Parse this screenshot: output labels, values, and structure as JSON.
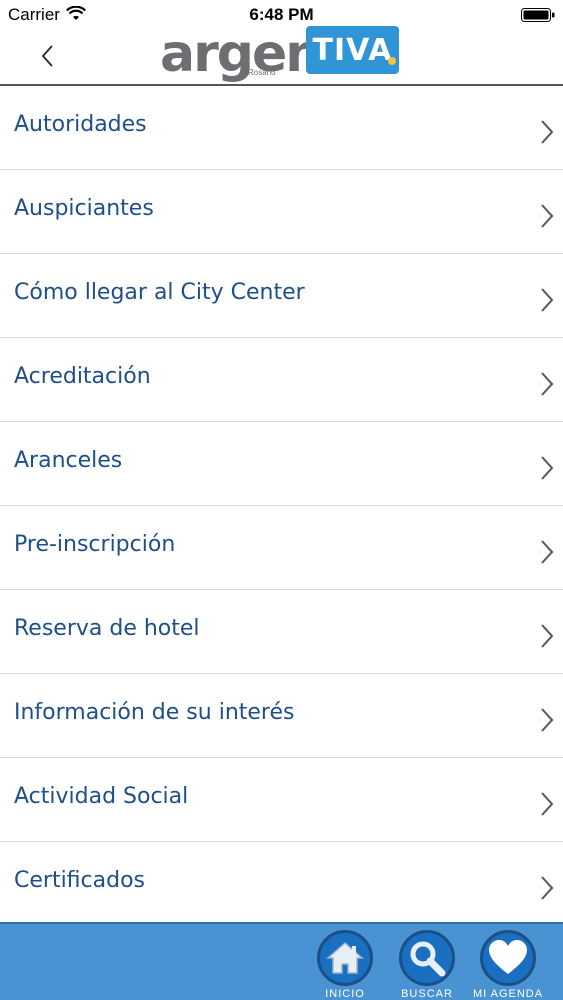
{
  "status_bar": {
    "carrier": "Carrier",
    "time": "6:48 PM"
  },
  "header": {
    "logo_text_left": "argen",
    "logo_text_right": "TIVA",
    "logo_subtitle": "Rosario",
    "back_icon": "chevron-left-icon"
  },
  "menu": {
    "items": [
      {
        "label": "Autoridades"
      },
      {
        "label": "Auspiciantes"
      },
      {
        "label": "Cómo llegar al City Center"
      },
      {
        "label": "Acreditación"
      },
      {
        "label": "Aranceles"
      },
      {
        "label": "Pre-inscripción"
      },
      {
        "label": "Reserva de hotel"
      },
      {
        "label": "Información de su interés"
      },
      {
        "label": "Actividad Social"
      },
      {
        "label": "Certificados"
      }
    ]
  },
  "tab_bar": {
    "tabs": [
      {
        "label": "INICIO",
        "icon": "home-icon"
      },
      {
        "label": "BUSCAR",
        "icon": "search-icon"
      },
      {
        "label": "MI AGENDA",
        "icon": "heart-icon"
      }
    ]
  },
  "colors": {
    "menu_text": "#1e4f8a",
    "tab_bar_bg": "#4a93d3",
    "tab_circle": "#1b6fc1",
    "logo_blue": "#2f95d6",
    "logo_gray": "#6d6e71"
  }
}
